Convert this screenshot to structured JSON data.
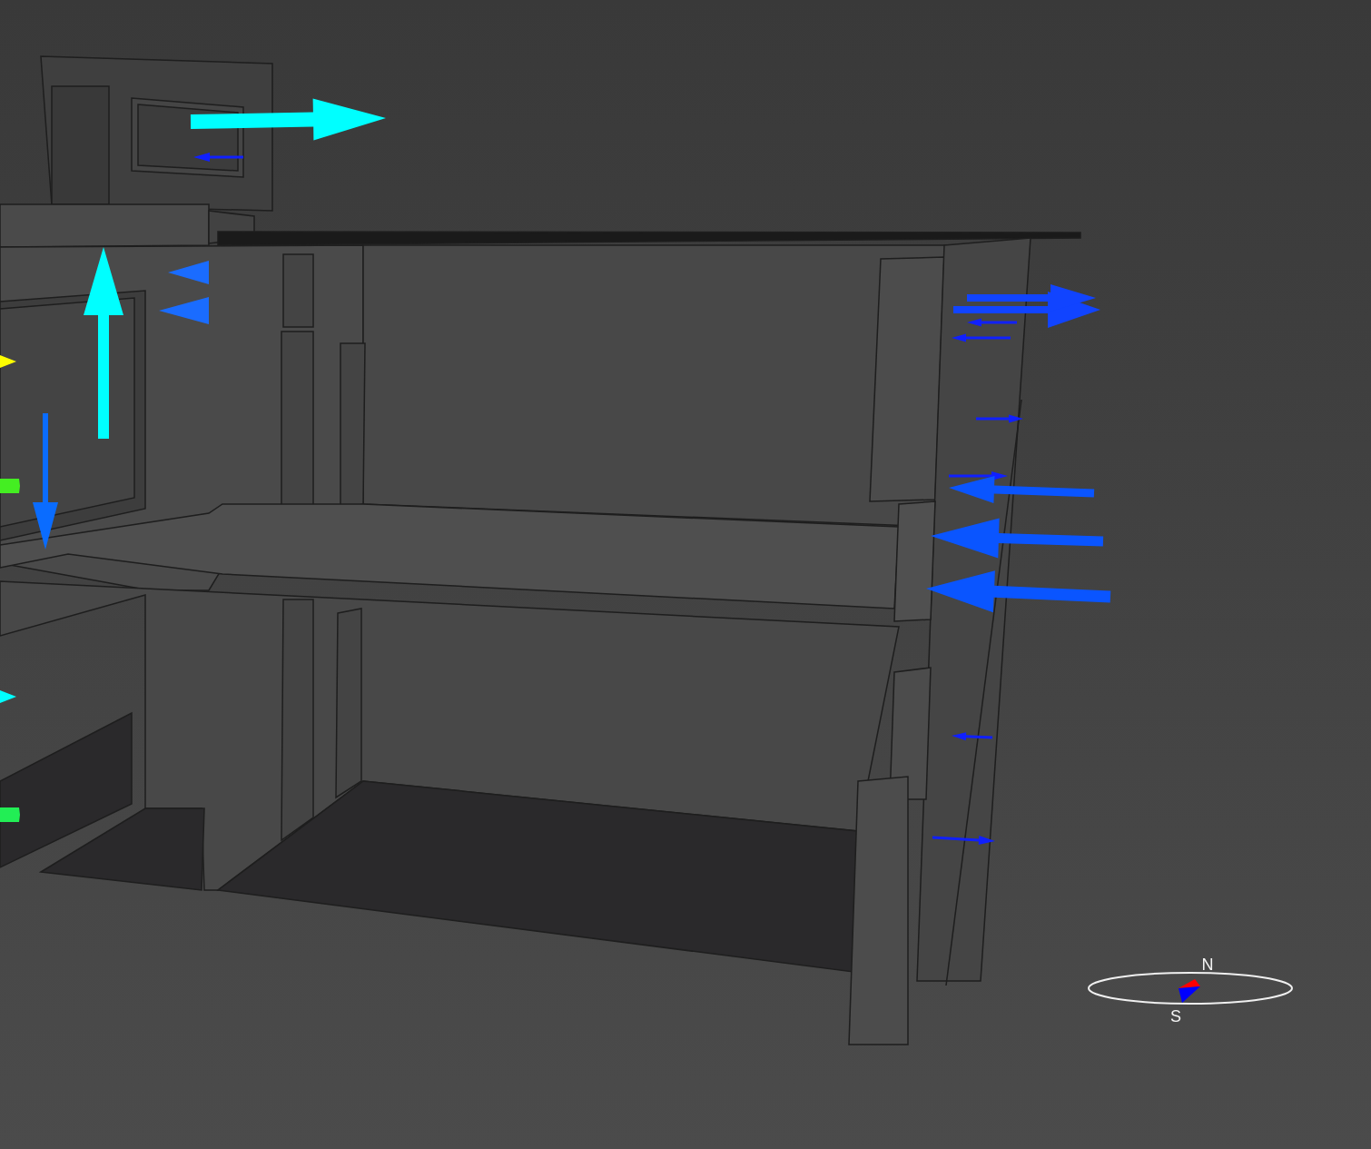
{
  "viewport": {
    "compass": {
      "north_label": "N",
      "south_label": "S"
    }
  }
}
